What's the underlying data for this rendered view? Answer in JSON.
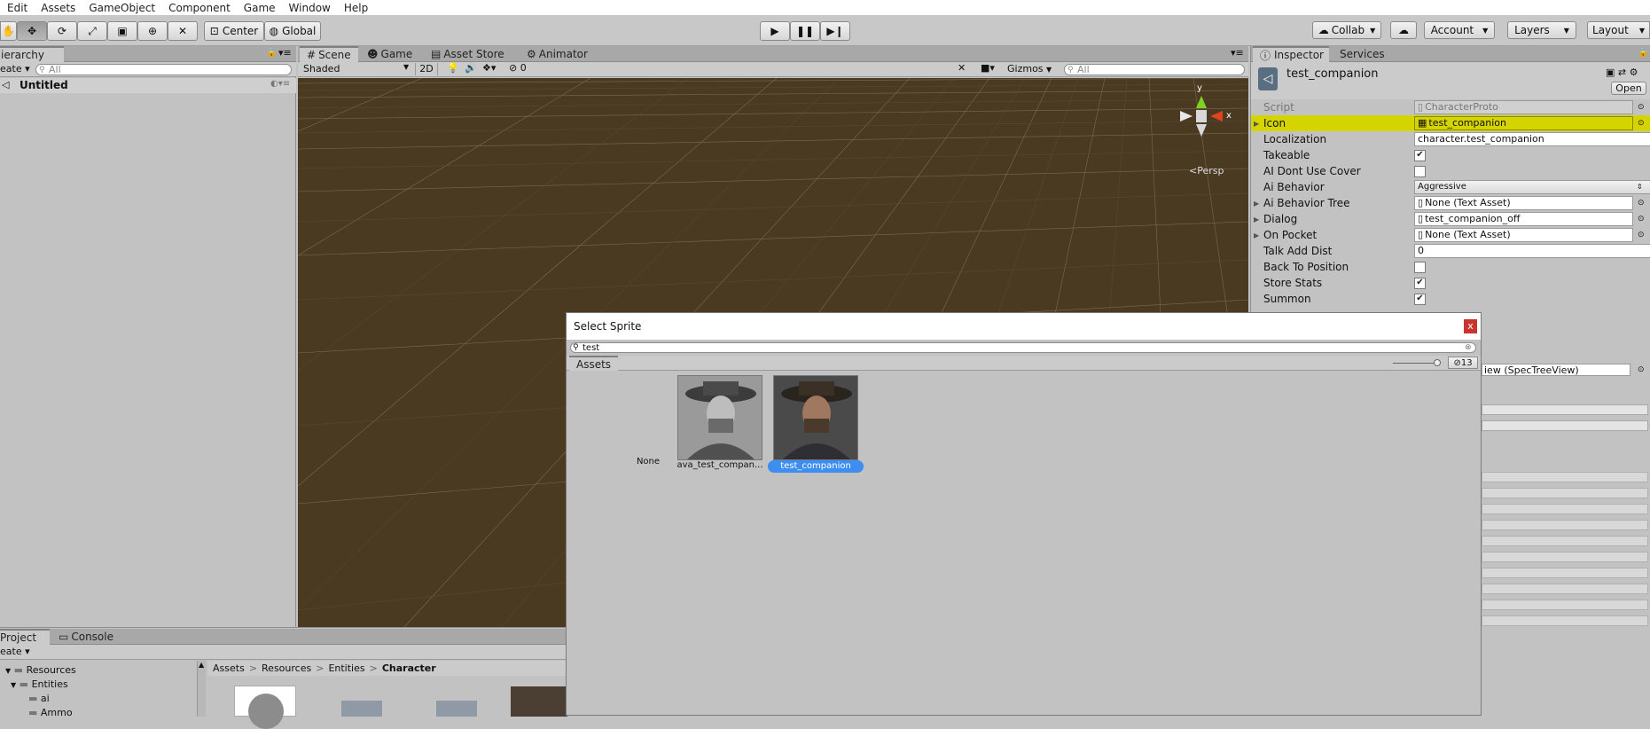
{
  "menu": [
    "Edit",
    "Assets",
    "GameObject",
    "Component",
    "Game",
    "Window",
    "Help"
  ],
  "toolbar": {
    "pivot_center": "Center",
    "pivot_global": "Global",
    "collab": "Collab",
    "account": "Account",
    "layers": "Layers",
    "layout": "Layout"
  },
  "hierarchy": {
    "tab": "Hierarchy",
    "create": "eate",
    "search_placeholder": "All",
    "scene_name": "Untitled"
  },
  "scene": {
    "tabs": [
      "Scene",
      "Game",
      "Asset Store",
      "Animator"
    ],
    "shading": "Shaded",
    "mode2d": "2D",
    "effects_count": "0",
    "gizmos": "Gizmos",
    "search_placeholder": "All",
    "persp": "Persp",
    "axis_y": "y",
    "axis_x": "x"
  },
  "inspector": {
    "tabs": [
      "Inspector",
      "Services"
    ],
    "object_name": "test_companion",
    "open": "Open",
    "rows": [
      {
        "label": "Script",
        "value": "CharacterProto",
        "kind": "field"
      },
      {
        "label": "Icon",
        "value": "test_companion",
        "kind": "field"
      },
      {
        "label": "Localization",
        "value": "character.test_companion",
        "kind": "text"
      },
      {
        "label": "Takeable",
        "value": "✔",
        "kind": "check"
      },
      {
        "label": "AI Dont Use Cover",
        "value": "",
        "kind": "check"
      },
      {
        "label": "Ai Behavior",
        "value": "Aggressive",
        "kind": "dropdown"
      },
      {
        "label": "Ai Behavior Tree",
        "value": "None (Text Asset)",
        "kind": "field"
      },
      {
        "label": "Dialog",
        "value": "test_companion_off",
        "kind": "field"
      },
      {
        "label": "On Pocket",
        "value": "None (Text Asset)",
        "kind": "field"
      },
      {
        "label": "Talk Add Dist",
        "value": "0",
        "kind": "text"
      },
      {
        "label": "Back To Position",
        "value": "",
        "kind": "check"
      },
      {
        "label": "Store Stats",
        "value": "✔",
        "kind": "check"
      },
      {
        "label": "Summon",
        "value": "✔",
        "kind": "check"
      }
    ],
    "partial_field": "iew (SpecTreeView)"
  },
  "project": {
    "tabs": [
      "Project",
      "Console"
    ],
    "create": "eate",
    "tree": [
      "Resources",
      "Entities",
      "ai",
      "Ammo"
    ],
    "breadcrumb": [
      "Assets",
      "Resources",
      "Entities",
      "Character"
    ]
  },
  "dialog": {
    "title": "Select Sprite",
    "close": "x",
    "search_value": "test",
    "tab": "Assets",
    "count": "13",
    "items": [
      {
        "label": "None",
        "selected": false
      },
      {
        "label": "ava_test_compan...",
        "selected": false
      },
      {
        "label": "test_companion",
        "selected": true
      }
    ]
  },
  "colors": {
    "highlight": "#d4d400",
    "selection": "#3d8ef0",
    "scene_ground": "#4a3a22",
    "close_red": "#c9342f"
  }
}
